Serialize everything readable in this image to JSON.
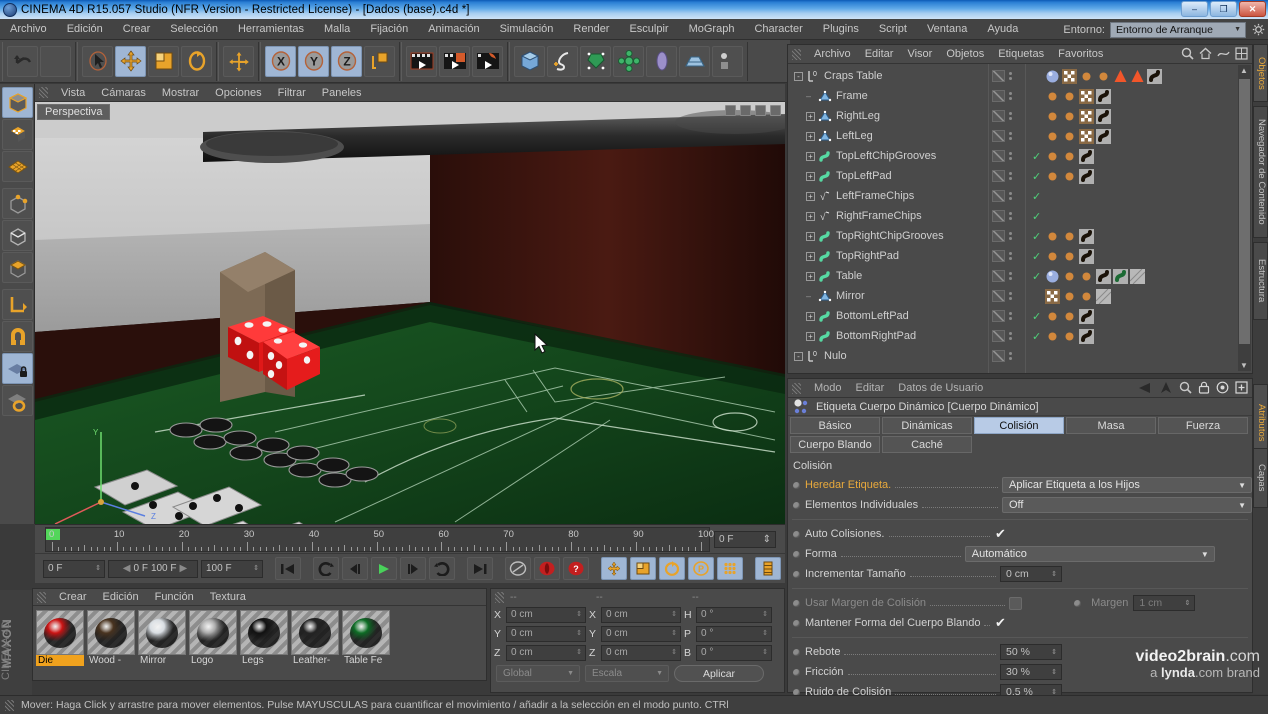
{
  "window": {
    "title": "CINEMA 4D R15.057 Studio (NFR Version - Restricted License) - [Dados (base).c4d *]",
    "minimize": "–",
    "restore": "❐",
    "close": "✕"
  },
  "menubar": {
    "items": [
      "Archivo",
      "Edición",
      "Crear",
      "Selección",
      "Herramientas",
      "Malla",
      "Fijación",
      "Animación",
      "Simulación",
      "Render",
      "Esculpir",
      "MoGraph",
      "Character",
      "Plugins",
      "Script",
      "Ventana",
      "Ayuda"
    ],
    "env_label": "Entorno:",
    "env_value": "Entorno de Arranque"
  },
  "viewport": {
    "menu": [
      "Vista",
      "Cámaras",
      "Mostrar",
      "Opciones",
      "Filtrar",
      "Paneles"
    ],
    "tag": "Perspectiva"
  },
  "timeline": {
    "ticks": [
      "0",
      "10",
      "20",
      "30",
      "40",
      "50",
      "60",
      "70",
      "80",
      "90",
      "100"
    ],
    "current_frame": "0 F"
  },
  "transport": {
    "start_frame": "0 F",
    "range_from": "0 F",
    "range_to": "100 F",
    "end_frame": "100 F"
  },
  "materials": {
    "menu": [
      "Crear",
      "Edición",
      "Función",
      "Textura"
    ],
    "items": [
      {
        "name": "Die",
        "color": "#cc1414",
        "selected": true
      },
      {
        "name": "Wood -",
        "color": "#4a3420",
        "selected": false
      },
      {
        "name": "Mirror",
        "color": "#d8dde2",
        "selected": false
      },
      {
        "name": "Logo",
        "color": "#a9a9a9",
        "selected": false
      },
      {
        "name": "Legs",
        "color": "#121212",
        "selected": false
      },
      {
        "name": "Leather-",
        "color": "#242424",
        "selected": false
      },
      {
        "name": "Table Fe",
        "color": "#0e6e26",
        "selected": false
      }
    ]
  },
  "coordinates": {
    "header_dashes": [
      "--",
      "--",
      "--"
    ],
    "rows": [
      {
        "label1": "X",
        "value1": "0 cm",
        "label2": "X",
        "value2": "0 cm",
        "label3": "H",
        "value3": "0 °"
      },
      {
        "label1": "Y",
        "value1": "0 cm",
        "label2": "Y",
        "value2": "0 cm",
        "label3": "P",
        "value3": "0 °"
      },
      {
        "label1": "Z",
        "value1": "0 cm",
        "label2": "Z",
        "value2": "0 cm",
        "label3": "B",
        "value3": "0 °"
      }
    ],
    "mode_select": "Global",
    "scale_select": "Escala",
    "apply_button": "Aplicar"
  },
  "objects_manager": {
    "menu": [
      "Archivo",
      "Editar",
      "Visor",
      "Objetos",
      "Etiquetas",
      "Favoritos"
    ],
    "rows": [
      {
        "label": "Craps Table",
        "depth": 0,
        "expander": "-",
        "icon": "null-object-icon",
        "check": false,
        "tags": [
          "sphere",
          "checker",
          "dot",
          "dot",
          "cone",
          "cone",
          "dynamics"
        ]
      },
      {
        "label": "Frame",
        "depth": 1,
        "expander": "",
        "icon": "polygon-object-icon",
        "check": false,
        "tags": [
          "dot",
          "dot",
          "checker",
          "dynamics"
        ]
      },
      {
        "label": "RightLeg",
        "depth": 1,
        "expander": "+",
        "icon": "polygon-object-icon",
        "check": false,
        "tags": [
          "dot",
          "dot",
          "checker",
          "dynamics"
        ]
      },
      {
        "label": "LeftLeg",
        "depth": 1,
        "expander": "+",
        "icon": "polygon-object-icon",
        "check": false,
        "tags": [
          "dot",
          "dot",
          "checker",
          "dynamics"
        ]
      },
      {
        "label": "TopLeftChipGrooves",
        "depth": 1,
        "expander": "+",
        "icon": "spline-green-icon",
        "check": true,
        "tags": [
          "dot",
          "dot",
          "dynamics"
        ]
      },
      {
        "label": "TopLeftPad",
        "depth": 1,
        "expander": "+",
        "icon": "spline-green-icon",
        "check": true,
        "tags": [
          "dot",
          "dot",
          "dynamics"
        ]
      },
      {
        "label": "LeftFrameChips",
        "depth": 1,
        "expander": "+",
        "icon": "formula-icon",
        "check": true,
        "tags": []
      },
      {
        "label": "RightFrameChips",
        "depth": 1,
        "expander": "+",
        "icon": "formula-icon",
        "check": true,
        "tags": []
      },
      {
        "label": "TopRightChipGrooves",
        "depth": 1,
        "expander": "+",
        "icon": "spline-green-icon",
        "check": true,
        "tags": [
          "dot",
          "dot",
          "dynamics"
        ]
      },
      {
        "label": "TopRightPad",
        "depth": 1,
        "expander": "+",
        "icon": "spline-green-icon",
        "check": true,
        "tags": [
          "dot",
          "dot",
          "dynamics"
        ]
      },
      {
        "label": "Table",
        "depth": 1,
        "expander": "+",
        "icon": "spline-green-icon",
        "check": true,
        "tags": [
          "sphere",
          "dot",
          "dot",
          "dynamics",
          "dynamics-green",
          "hatch"
        ]
      },
      {
        "label": "Mirror",
        "depth": 1,
        "expander": "",
        "icon": "polygon-object-icon",
        "check": false,
        "tags": [
          "checker",
          "dot",
          "dot",
          "hatch"
        ]
      },
      {
        "label": "BottomLeftPad",
        "depth": 1,
        "expander": "+",
        "icon": "spline-green-icon",
        "check": true,
        "tags": [
          "dot",
          "dot",
          "dynamics"
        ]
      },
      {
        "label": "BottomRightPad",
        "depth": 1,
        "expander": "+",
        "icon": "spline-green-icon",
        "check": true,
        "tags": [
          "dot",
          "dot",
          "dynamics"
        ]
      },
      {
        "label": "Nulo",
        "depth": 0,
        "expander": "-",
        "icon": "null-object-icon",
        "check": false,
        "tags": []
      }
    ]
  },
  "attributes_manager": {
    "menu": [
      "Modo",
      "Editar",
      "Datos de Usuario"
    ],
    "title": "Etiqueta Cuerpo Dinámico [Cuerpo Dinámico]",
    "tabs_row1": [
      "Básico",
      "Dinámicas",
      "Colisión",
      "Masa",
      "Fuerza"
    ],
    "tabs_row2": [
      "Cuerpo Blando",
      "Caché"
    ],
    "selected_tab": "Colisión",
    "section_title": "Colisión",
    "properties": [
      {
        "label": "Heredar Etiqueta.",
        "type": "select",
        "value": "Aplicar Etiqueta a los Hijos",
        "highlight": true
      },
      {
        "label": "Elementos Individuales",
        "type": "select",
        "value": "Off",
        "highlight": false
      },
      {
        "label": "Auto Colisiones.",
        "type": "check",
        "value": "✔",
        "highlight": false
      },
      {
        "label": "Forma",
        "type": "select",
        "value": "Automático",
        "highlight": false
      },
      {
        "label": "Incrementar Tamaño",
        "type": "num",
        "value": "0 cm",
        "highlight": false
      },
      {
        "label": "Usar Margen de Colisión",
        "type": "box",
        "value": "",
        "highlight": false,
        "dim": true,
        "extra_label": "Margen",
        "extra_value": "1 cm"
      },
      {
        "label": "Mantener Forma del Cuerpo Blando",
        "type": "check",
        "value": "✔",
        "highlight": false
      },
      {
        "label": "Rebote",
        "type": "num",
        "value": "50 %",
        "highlight": false
      },
      {
        "label": "Fricción",
        "type": "num",
        "value": "30 %",
        "highlight": false
      },
      {
        "label": "Ruido de Colisión",
        "type": "num",
        "value": "0.5 %",
        "highlight": false
      }
    ]
  },
  "right_tabs": [
    {
      "label": "Objetos",
      "active": true
    },
    {
      "label": "Navegador de Contenido",
      "active": false
    },
    {
      "label": "Estructura",
      "active": false
    },
    {
      "label": "Atributos",
      "active": true
    },
    {
      "label": "Capas",
      "active": false
    }
  ],
  "statusbar": {
    "text": "Mover: Haga Click y arrastre para mover elementos. Pulse MAYUSCULAS para cuantificar el movimiento / añadir a la selección en el modo punto. CTRl"
  },
  "watermark": {
    "line1_bold": "video2brain",
    "line1_rest": ".com",
    "line2_pre": "a ",
    "line2_bold": "lynda",
    "line2_rest": ".com brand"
  },
  "branding": {
    "maxon": "MAXON",
    "c4d": "CINEMA 4D"
  }
}
